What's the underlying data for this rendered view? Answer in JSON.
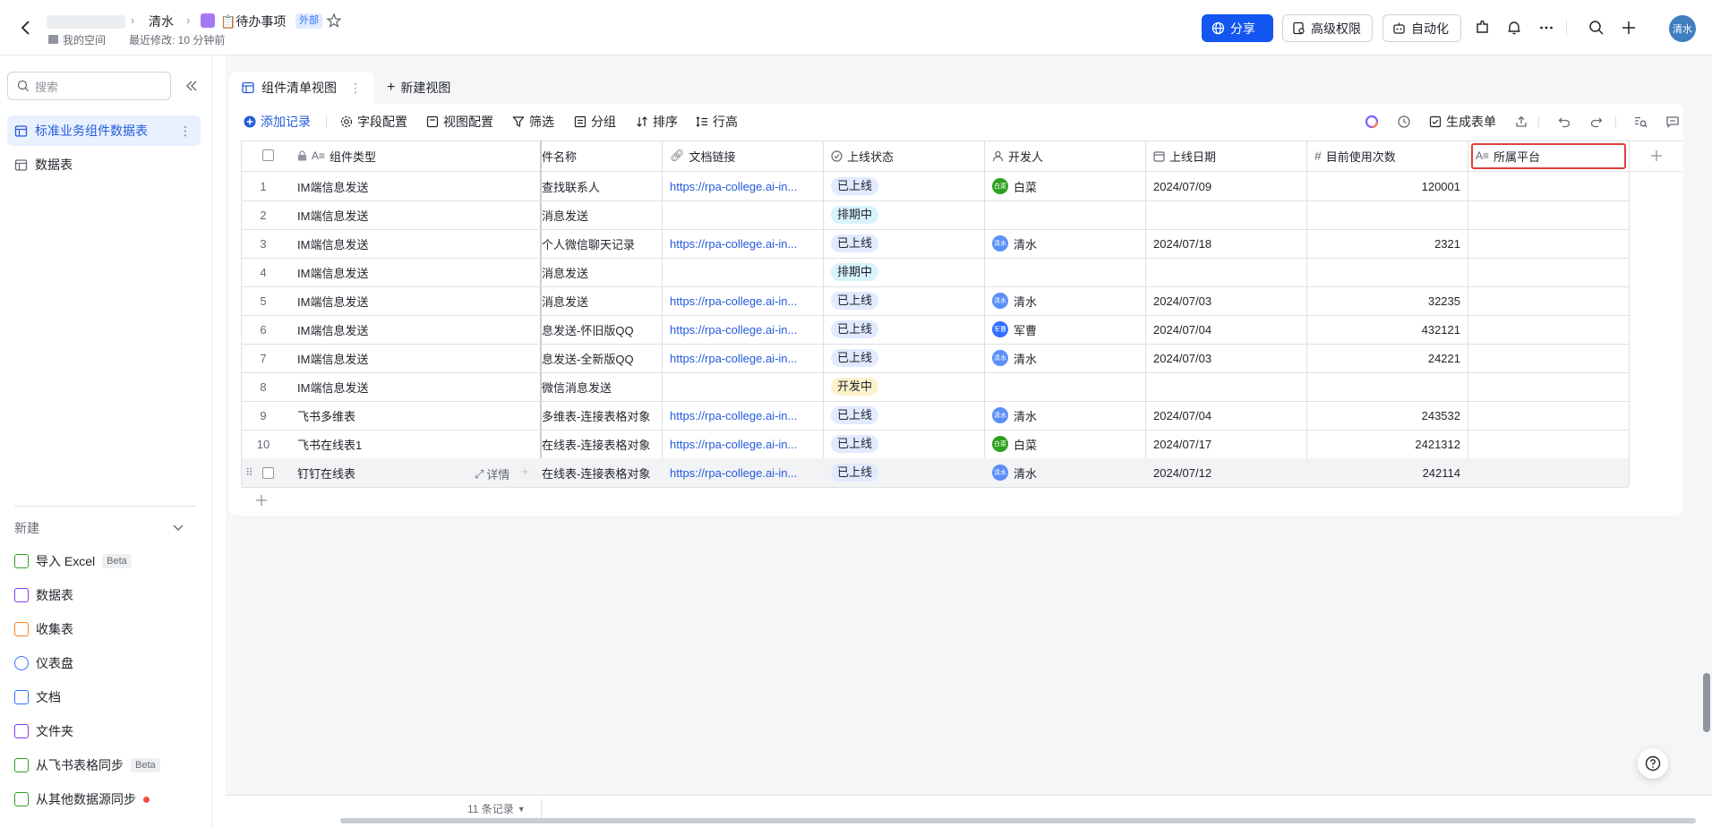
{
  "breadcrumb": {
    "parent": "清水",
    "title": "📋待办事项",
    "badge": "外部",
    "space": "我的空间",
    "modified": "最近修改: 10 分钟前"
  },
  "top_actions": {
    "share": "分享",
    "permission": "高级权限",
    "automation": "自动化",
    "user_avatar": "清水"
  },
  "sidebar": {
    "search_placeholder": "搜索",
    "items": [
      {
        "label": "标准业务组件数据表",
        "active": true
      },
      {
        "label": "数据表",
        "active": false
      }
    ],
    "new_section": "新建",
    "new_items": [
      {
        "label": "导入 Excel",
        "badge": "Beta",
        "color": "#2ea121"
      },
      {
        "label": "数据表",
        "badge": "",
        "color": "#7f3bf5"
      },
      {
        "label": "收集表",
        "badge": "",
        "color": "#ff811a"
      },
      {
        "label": "仪表盘",
        "badge": "",
        "color": "#3370ff"
      },
      {
        "label": "文档",
        "badge": "",
        "color": "#3370ff"
      },
      {
        "label": "文件夹",
        "badge": "",
        "color": "#7f3bf5"
      },
      {
        "label": "从飞书表格同步",
        "badge": "Beta",
        "color": "#2ea121"
      },
      {
        "label": "从其他数据源同步",
        "badge": "",
        "color": "#2ea121"
      }
    ]
  },
  "views": {
    "active": "组件清单视图",
    "new_view": "新建视图"
  },
  "toolbar": {
    "add_record": "添加记录",
    "field_config": "字段配置",
    "view_config": "视图配置",
    "filter": "筛选",
    "group": "分组",
    "sort": "排序",
    "row_height": "行高",
    "generate_form": "生成表单"
  },
  "columns": {
    "type": "组件类型",
    "name": "件名称",
    "link": "文档链接",
    "status": "上线状态",
    "developer": "开发人",
    "date": "上线日期",
    "usage": "目前使用次数",
    "platform": "所属平台"
  },
  "row_detail": "详情",
  "rows": [
    {
      "idx": "1",
      "type": "IM端信息发送",
      "name": "查找联系人",
      "link": "https://rpa-college.ai-in...",
      "status": "已上线",
      "dev": "白菜",
      "dev_abbr": "白菜",
      "dev_color": "#2ea121",
      "date": "2024/07/09",
      "usage": "120001"
    },
    {
      "idx": "2",
      "type": "IM端信息发送",
      "name": "消息发送",
      "link": "",
      "status": "排期中",
      "dev": "",
      "dev_abbr": "",
      "dev_color": "",
      "date": "",
      "usage": ""
    },
    {
      "idx": "3",
      "type": "IM端信息发送",
      "name": "个人微信聊天记录",
      "link": "https://rpa-college.ai-in...",
      "status": "已上线",
      "dev": "清水",
      "dev_abbr": "清水",
      "dev_color": "#5b8ff9",
      "date": "2024/07/18",
      "usage": "2321"
    },
    {
      "idx": "4",
      "type": "IM端信息发送",
      "name": "消息发送",
      "link": "",
      "status": "排期中",
      "dev": "",
      "dev_abbr": "",
      "dev_color": "",
      "date": "",
      "usage": ""
    },
    {
      "idx": "5",
      "type": "IM端信息发送",
      "name": "消息发送",
      "link": "https://rpa-college.ai-in...",
      "status": "已上线",
      "dev": "清水",
      "dev_abbr": "清水",
      "dev_color": "#5b8ff9",
      "date": "2024/07/03",
      "usage": "32235"
    },
    {
      "idx": "6",
      "type": "IM端信息发送",
      "name": "息发送-怀旧版QQ",
      "link": "https://rpa-college.ai-in...",
      "status": "已上线",
      "dev": "军曹",
      "dev_abbr": "军曹",
      "dev_color": "#3370ff",
      "date": "2024/07/04",
      "usage": "432121"
    },
    {
      "idx": "7",
      "type": "IM端信息发送",
      "name": "息发送-全新版QQ",
      "link": "https://rpa-college.ai-in...",
      "status": "已上线",
      "dev": "清水",
      "dev_abbr": "清水",
      "dev_color": "#5b8ff9",
      "date": "2024/07/03",
      "usage": "24221"
    },
    {
      "idx": "8",
      "type": "IM端信息发送",
      "name": "微信消息发送",
      "link": "",
      "status": "开发中",
      "dev": "",
      "dev_abbr": "",
      "dev_color": "",
      "date": "",
      "usage": ""
    },
    {
      "idx": "9",
      "type": "飞书多维表",
      "name": "多维表-连接表格对象",
      "link": "https://rpa-college.ai-in...",
      "status": "已上线",
      "dev": "清水",
      "dev_abbr": "清水",
      "dev_color": "#5b8ff9",
      "date": "2024/07/04",
      "usage": "243532"
    },
    {
      "idx": "10",
      "type": "飞书在线表1",
      "name": "在线表-连接表格对象",
      "link": "https://rpa-college.ai-in...",
      "status": "已上线",
      "dev": "白菜",
      "dev_abbr": "白菜",
      "dev_color": "#2ea121",
      "date": "2024/07/17",
      "usage": "2421312"
    },
    {
      "idx": "",
      "type": "钉钉在线表",
      "name": "在线表-连接表格对象",
      "link": "https://rpa-college.ai-in...",
      "status": "已上线",
      "dev": "清水",
      "dev_abbr": "清水",
      "dev_color": "#5b8ff9",
      "date": "2024/07/12",
      "usage": "242114"
    }
  ],
  "status_colors": {
    "已上线": {
      "bg": "#e1eaff",
      "fg": "#1f2329"
    },
    "排期中": {
      "bg": "#d9f3fd",
      "fg": "#1f2329"
    },
    "开发中": {
      "bg": "#fdf2cb",
      "fg": "#1f2329"
    }
  },
  "footer": {
    "record_count": "11 条记录"
  }
}
